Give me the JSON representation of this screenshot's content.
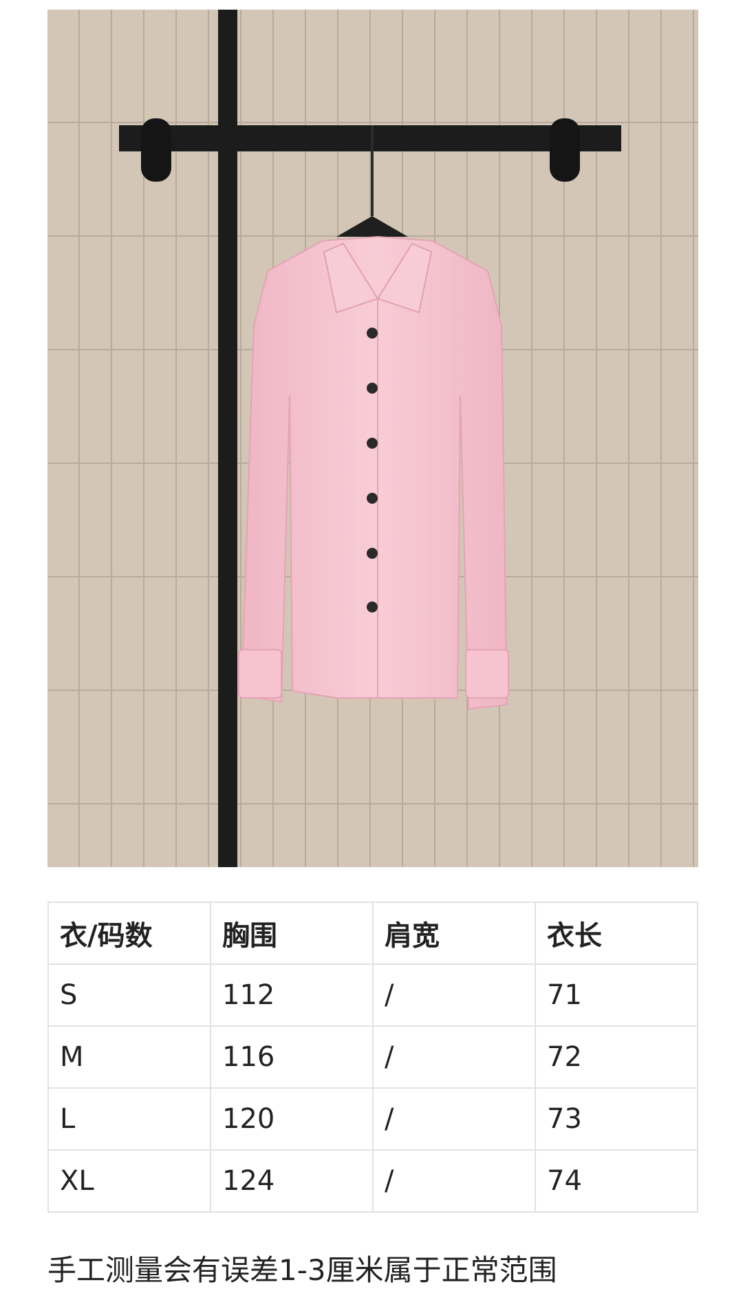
{
  "photo": {
    "alt_subject": "pink-shirt-on-hanger",
    "colors": {
      "wall": "#cdbfae",
      "grout": "#b9ab99",
      "rail": "#1c1c1c",
      "shirt": "#f6c3cf",
      "shirt_shadow": "#e9a9b9",
      "button": "#2a2a2a"
    }
  },
  "size_table": {
    "headers": [
      "衣/码数",
      "胸围",
      "肩宽",
      "衣长"
    ],
    "rows": [
      [
        "S",
        "112",
        "/",
        "71"
      ],
      [
        "M",
        "116",
        "/",
        "72"
      ],
      [
        "L",
        "120",
        "/",
        "73"
      ],
      [
        "XL",
        "124",
        "/",
        "74"
      ]
    ]
  },
  "note": "手工测量会有误差1-3厘米属于正常范围"
}
